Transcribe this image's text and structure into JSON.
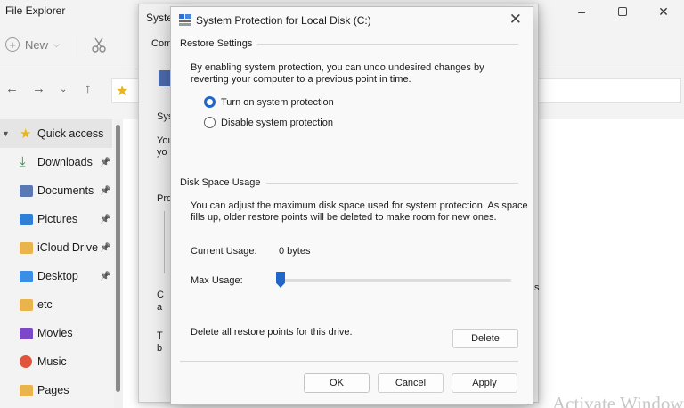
{
  "explorer": {
    "title": "File Explorer",
    "toolbar": {
      "new_label": "New"
    },
    "sidebar": [
      {
        "label": "Quick access",
        "icon": "star-icon",
        "color": "#e8b520",
        "active": true,
        "pinned": false
      },
      {
        "label": "Downloads",
        "icon": "download-icon",
        "color": "#2b8a3e",
        "pinned": true
      },
      {
        "label": "Documents",
        "icon": "documents-icon",
        "color": "#5a78b4",
        "pinned": true
      },
      {
        "label": "Pictures",
        "icon": "pictures-icon",
        "color": "#2f7fd6",
        "pinned": true
      },
      {
        "label": "iCloud Drive",
        "icon": "folder-icon",
        "color": "#e9b44c",
        "pinned": true
      },
      {
        "label": "Desktop",
        "icon": "desktop-icon",
        "color": "#3a8ee6",
        "pinned": true
      },
      {
        "label": "etc",
        "icon": "folder-icon",
        "color": "#e9b44c",
        "pinned": false
      },
      {
        "label": "Movies",
        "icon": "movies-icon",
        "color": "#7b49c7",
        "pinned": false
      },
      {
        "label": "Music",
        "icon": "music-icon",
        "color": "#e0543c",
        "pinned": false
      },
      {
        "label": "Pages",
        "icon": "folder-icon",
        "color": "#e9b44c",
        "pinned": false
      }
    ],
    "watermark": "Activate Windows"
  },
  "system_properties": {
    "title": "Syste",
    "tab_fragment": "Com",
    "fragments": [
      "Sys",
      "You",
      "yo",
      "Pro",
      "C",
      "a",
      "T",
      "b"
    ],
    "right_fragment": "s"
  },
  "dialog": {
    "title": "System Protection for Local Disk (C:)",
    "restore_settings": {
      "heading": "Restore Settings",
      "description_line1": "By enabling system protection, you can undo undesired changes by",
      "description_line2": "reverting your computer to a previous point in time.",
      "options": [
        {
          "label": "Turn on system protection",
          "checked": true
        },
        {
          "label": "Disable system protection",
          "checked": false
        }
      ]
    },
    "disk_space": {
      "heading": "Disk Space Usage",
      "description_line1": "You can adjust the maximum disk space used for system protection. As space",
      "description_line2": "fills up, older restore points will be deleted to make room for new ones.",
      "current_usage_label": "Current Usage:",
      "current_usage_value": "0 bytes",
      "max_usage_label": "Max Usage:",
      "max_usage_fraction": 0.0
    },
    "delete_text": "Delete all restore points for this drive.",
    "buttons": {
      "delete": "Delete",
      "ok": "OK",
      "cancel": "Cancel",
      "apply": "Apply"
    },
    "accent": "#2266c9"
  }
}
